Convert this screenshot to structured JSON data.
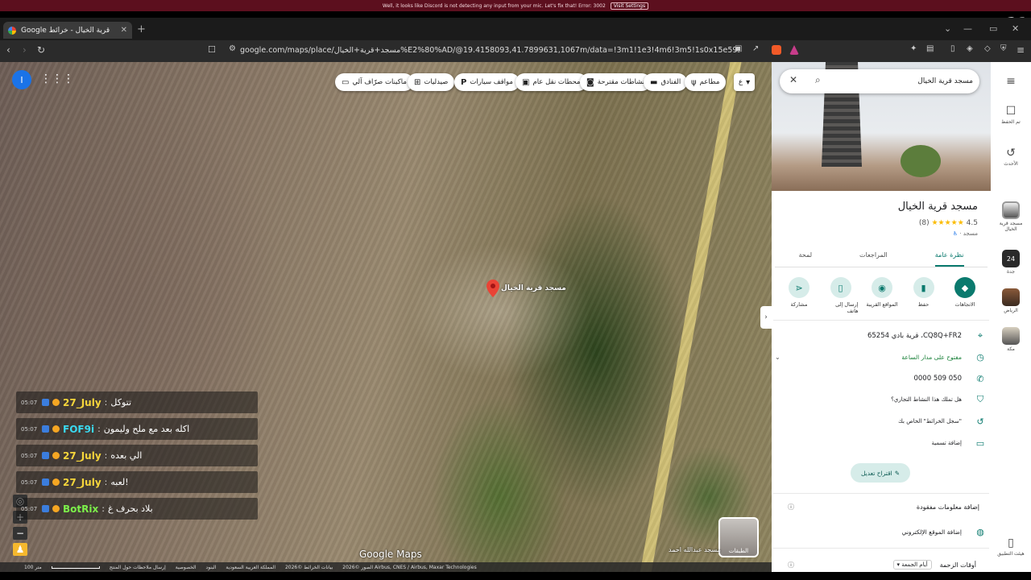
{
  "discord": {
    "message": "Well, it looks like Discord is not detecting any input from your mic. Let's fix that!  Error: 3002",
    "button": "Visit Settings"
  },
  "browser": {
    "tab_title": "Google قرية الخيال - خرائط",
    "url": "google.com/maps/place/مسجد+قرية+الخيال%E2%80%AD/@19.4158093,41.7899631,1067m/data=!3m1!1e3!4m6!3m5!1s0x15e5996c3559e6b9:0..."
  },
  "map": {
    "chips": [
      {
        "label": "مطاعم",
        "icon": "fork-knife-icon"
      },
      {
        "label": "الفنادق",
        "icon": "bed-icon"
      },
      {
        "label": "نشاطات مقترحة",
        "icon": "camera-icon"
      },
      {
        "label": "محطات نقل عام",
        "icon": "bus-icon"
      },
      {
        "label": "مواقف سيارات",
        "icon": "parking-icon"
      },
      {
        "label": "صيدليات",
        "icon": "pharmacy-icon"
      },
      {
        "label": "ماكينات صرّاف آلي",
        "icon": "atm-icon"
      }
    ],
    "more_chip": "ع",
    "account_initial": "I",
    "pin_label": "مسجد قرية الخيال",
    "layers_label": "الطبقات",
    "nearby_label": "مسجد عبدالله احمد",
    "google_logo": "Google Maps",
    "footer": [
      "100 متر",
      "إرسال ملاحظات حول المنتج",
      "الخصوصية",
      "البنود",
      "المملكة العربية السعودية",
      "بيانات الخرائط ©2026",
      "الصور ©2026 Airbus, CNES / Airbus, Maxar Technologies"
    ]
  },
  "chat": [
    {
      "time": "05:07",
      "user": "27_July",
      "text": "تتوكل",
      "color": "#f5d53b"
    },
    {
      "time": "05:07",
      "user": "FOF9i",
      "text": "اكله بعد مع ملح وليمون",
      "color": "#3ad9f0"
    },
    {
      "time": "05:07",
      "user": "27_July",
      "text": "الي بعده",
      "color": "#f5d53b"
    },
    {
      "time": "05:07",
      "user": "27_July",
      "text": "لعبه!",
      "color": "#f5d53b"
    },
    {
      "time": "05:07",
      "user": "BotRix",
      "text": "بلاد بحرف غ",
      "color": "#7cf04a"
    }
  ],
  "panel": {
    "search_value": "مسجد قرية الخيال",
    "title": "مسجد قرية الخيال",
    "rating": "4.5",
    "reviews": "(8)",
    "category": "مسجد ·",
    "tabs": [
      "نظرة عامة",
      "المراجعات",
      "لمحة"
    ],
    "actions": [
      "الاتجاهات",
      "حفظ",
      "المواقع القريبة",
      "إرسال إلى هاتف",
      "مشاركة"
    ],
    "address": "CQ8Q+FR2، قرية بادي 65254",
    "hours": "مفتوح على مدار الساعة",
    "phone": "050 509 0000",
    "own_business": "هل تملك هذا النشاط التجاري؟",
    "history": "\"سجل الخرائط\" الخاص بك",
    "add_label": "إضافة تسمية",
    "suggest_edit": "اقتراح تعديل",
    "add_missing": "إضافة معلومات مفقودة",
    "add_website": "إضافة الموقع الإلكتروني",
    "busy_times": "أوقات الزحمة",
    "busy_day": "أيام الجمعة"
  },
  "rail": {
    "saved": "تم الحفظ",
    "recent": "الأحدث",
    "recent1": "مسجد قرية الخيال",
    "recent2": "جدة",
    "recent3": "الرياض",
    "recent4": "مكة",
    "get_app": "هيئت التطبيق"
  }
}
